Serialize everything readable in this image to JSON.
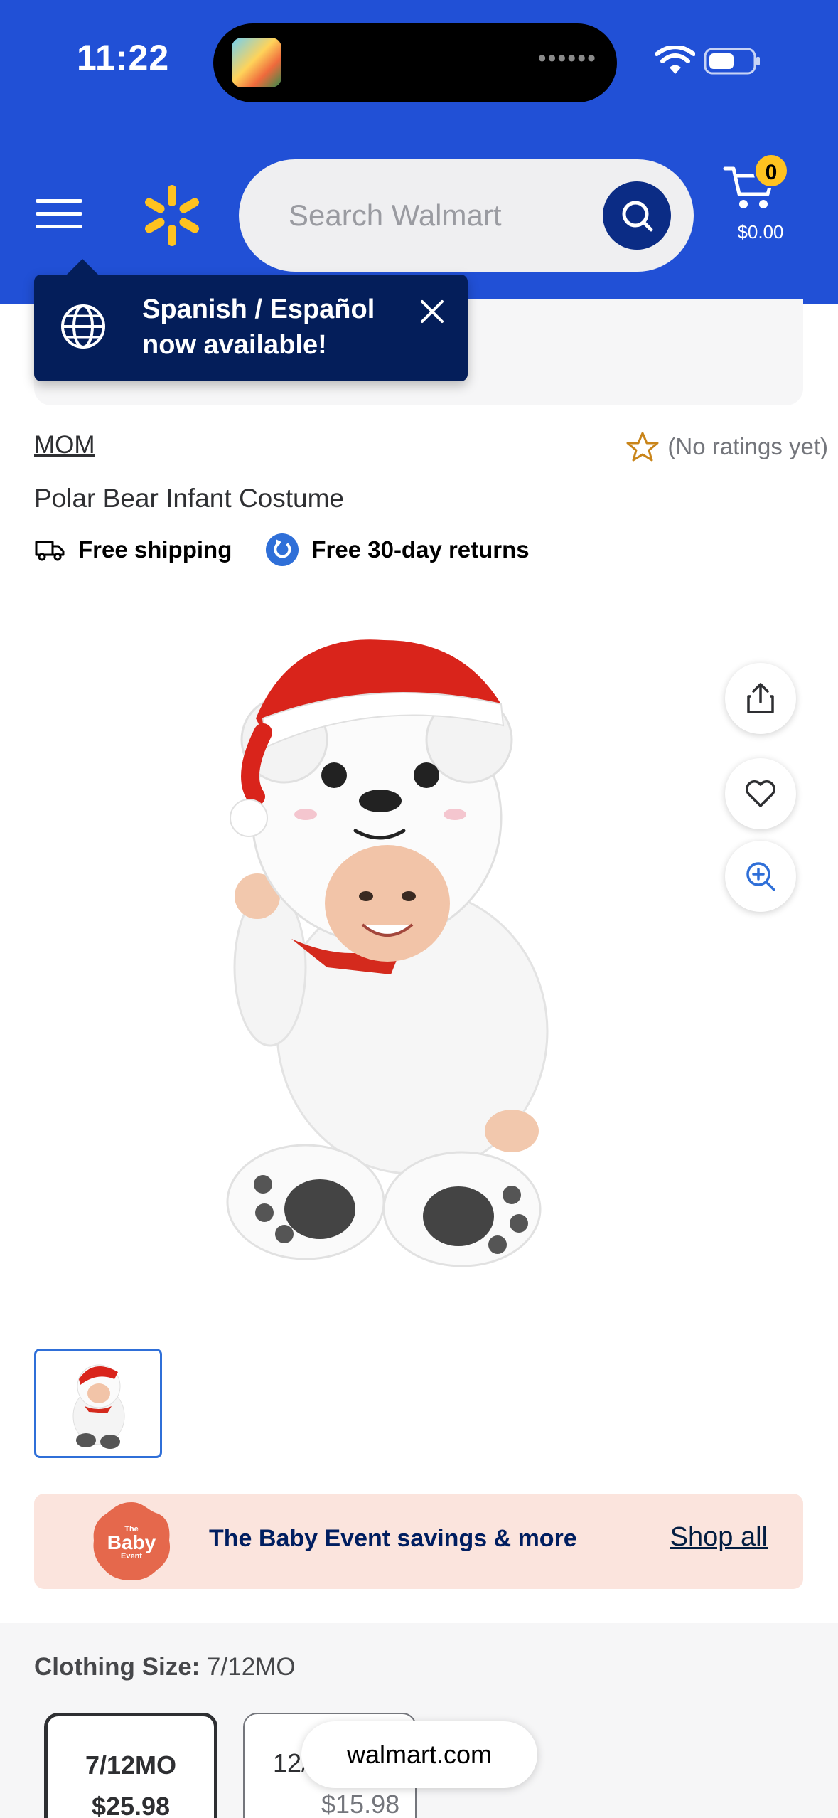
{
  "status_bar": {
    "time": "11:22"
  },
  "header": {
    "search": {
      "placeholder": "Search Walmart"
    },
    "cart": {
      "count": "0",
      "total": "$0.00"
    },
    "colors": {
      "brand_blue": "#2150d6",
      "spark_yellow": "#ffc220",
      "navy": "#041e5a"
    }
  },
  "tooltip": {
    "line1": "Spanish / Español",
    "line2": "now available!"
  },
  "product": {
    "brand": "MOM",
    "rating_text": "(No ratings yet)",
    "title": "Polar Bear Infant Costume",
    "badges": {
      "shipping": "Free shipping",
      "returns": "Free 30-day returns"
    }
  },
  "promo": {
    "logo_line1": "The",
    "logo_line2": "Baby",
    "logo_line3": "Event",
    "text": "The Baby Event savings & more",
    "link": "Shop all"
  },
  "size_selector": {
    "label": "Clothing Size:",
    "selected": "7/12MO",
    "options": [
      {
        "name": "7/12MO",
        "price": "$25.98"
      },
      {
        "name": "12/",
        "price": "$15.98"
      }
    ]
  },
  "browser": {
    "url": "walmart.com"
  }
}
